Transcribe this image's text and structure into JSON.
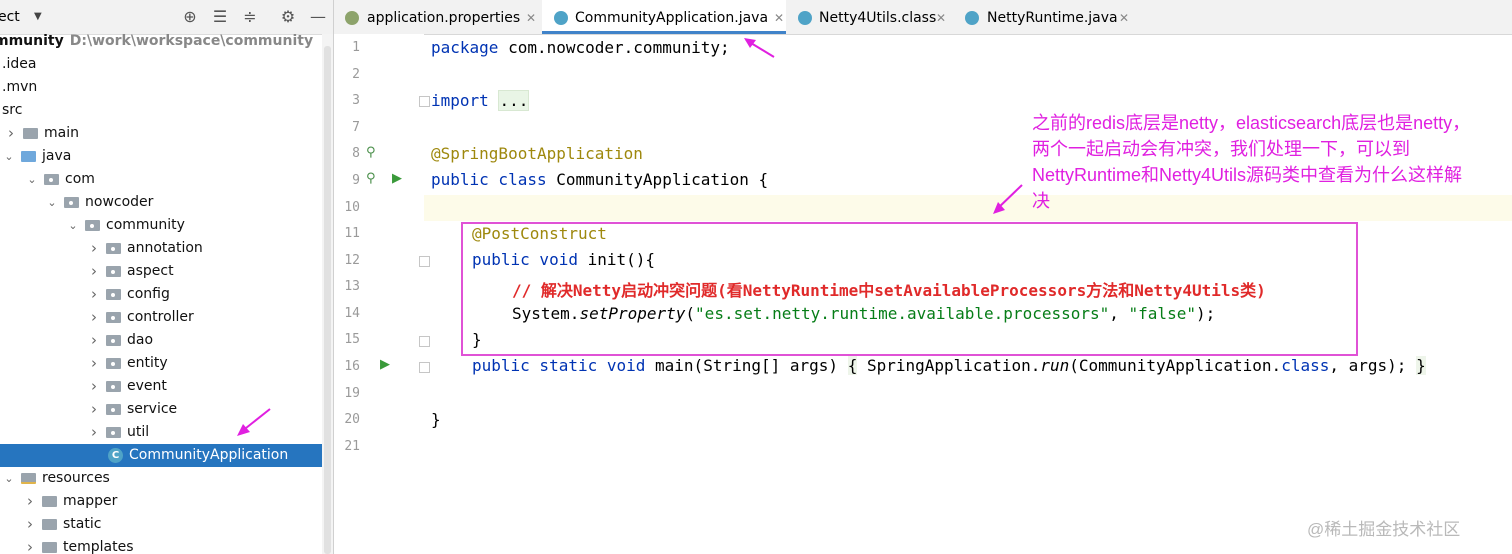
{
  "project_panel": {
    "title": "ect",
    "tree": [
      {
        "label": "mmunity",
        "path": "D:\\work\\workspace\\community",
        "kind": "root"
      },
      {
        "label": ".idea",
        "kind": "plain"
      },
      {
        "label": ".mvn",
        "kind": "plain"
      },
      {
        "label": "src",
        "kind": "plain"
      },
      {
        "label": "main",
        "kind": "folder"
      },
      {
        "label": "java",
        "kind": "src-folder",
        "expanded": true
      },
      {
        "label": "com",
        "kind": "package",
        "expanded": true
      },
      {
        "label": "nowcoder",
        "kind": "package",
        "expanded": true
      },
      {
        "label": "community",
        "kind": "package",
        "expanded": true
      },
      {
        "label": "annotation",
        "kind": "package"
      },
      {
        "label": "aspect",
        "kind": "package"
      },
      {
        "label": "config",
        "kind": "package"
      },
      {
        "label": "controller",
        "kind": "package"
      },
      {
        "label": "dao",
        "kind": "package"
      },
      {
        "label": "entity",
        "kind": "package"
      },
      {
        "label": "event",
        "kind": "package"
      },
      {
        "label": "service",
        "kind": "package"
      },
      {
        "label": "util",
        "kind": "package"
      },
      {
        "label": "CommunityApplication",
        "kind": "class",
        "selected": true
      },
      {
        "label": "resources",
        "kind": "resources-folder",
        "expanded": true
      },
      {
        "label": "mapper",
        "kind": "folder"
      },
      {
        "label": "static",
        "kind": "folder"
      },
      {
        "label": "templates",
        "kind": "folder"
      }
    ]
  },
  "tabs": [
    {
      "label": "application.properties",
      "icon": "properties-file-icon",
      "active": false
    },
    {
      "label": "CommunityApplication.java",
      "icon": "spring-class-icon",
      "active": true
    },
    {
      "label": "Netty4Utils.class",
      "icon": "class-icon",
      "active": false
    },
    {
      "label": "NettyRuntime.java",
      "icon": "class-icon",
      "active": false
    }
  ],
  "line_numbers": [
    "1",
    "2",
    "3",
    "7",
    "8",
    "9",
    "10",
    "11",
    "12",
    "13",
    "14",
    "15",
    "16",
    "19",
    "20",
    "21"
  ],
  "code": {
    "l1_kw": "package",
    "l1_rest": " com.nowcoder.community;",
    "l3_kw": "import",
    "l3_fold": "...",
    "l8_ann": "@SpringBootApplication",
    "l9_kw": "public class",
    "l9_rest": " CommunityApplication {",
    "l11_ann": "@PostConstruct",
    "l12_kw": "public void",
    "l12_rest": " init(){",
    "l13_comment": "// 解决Netty启动冲突问题(看NettyRuntime中setAvailableProcessors方法和Netty4Utils类)",
    "l14_a": "System.",
    "l14_method": "setProperty",
    "l14_b": "(",
    "l14_str1": "\"es.set.netty.runtime.available.processors\"",
    "l14_c": ", ",
    "l14_str2": "\"false\"",
    "l14_d": ");",
    "l15": "}",
    "l16_kw": "public static void",
    "l16_a": " main(String[] args) ",
    "l16_open": "{",
    "l16_b": " SpringApplication.",
    "l16_method": "run",
    "l16_c": "(CommunityApplication.",
    "l16_kw2": "class",
    "l16_d": ", args); ",
    "l16_close": "}",
    "l20": "}"
  },
  "note_lines": [
    "之前的redis底层是netty，elasticsearch底层也是netty，",
    "两个一起启动会有冲突，我们处理一下，可以到",
    "NettyRuntime和Netty4Utils源码类中查看为什么这样解",
    "决"
  ],
  "watermark": "@稀土掘金技术社区",
  "colors": {
    "selection": "#2675bf",
    "annotation_pink": "#e020e0",
    "highlight_box": "#e052d6",
    "keyword": "#0033b3",
    "annotation": "#9e880d",
    "string": "#067d17",
    "comment": "#e02a2a"
  }
}
